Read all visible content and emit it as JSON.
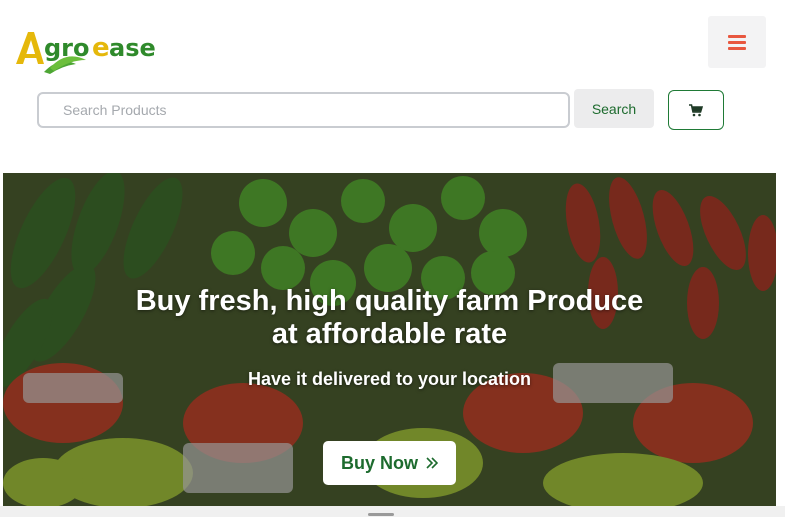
{
  "brand": {
    "name": "AgroEase"
  },
  "header": {
    "menu_icon": "hamburger-icon"
  },
  "search": {
    "placeholder": "Search Products",
    "value": "",
    "button_label": "Search"
  },
  "cart": {
    "icon": "cart-icon"
  },
  "hero": {
    "title_line1": "Buy fresh, high quality farm Produce",
    "title_line2": "at affordable rate",
    "subtitle": "Have it delivered to your location",
    "cta_label": "Buy Now",
    "cta_icon": "double-chevron-right-icon"
  },
  "colors": {
    "brand_green": "#1d6b2e",
    "brand_yellow": "#e5b80b",
    "menu_accent": "#e8573f"
  }
}
